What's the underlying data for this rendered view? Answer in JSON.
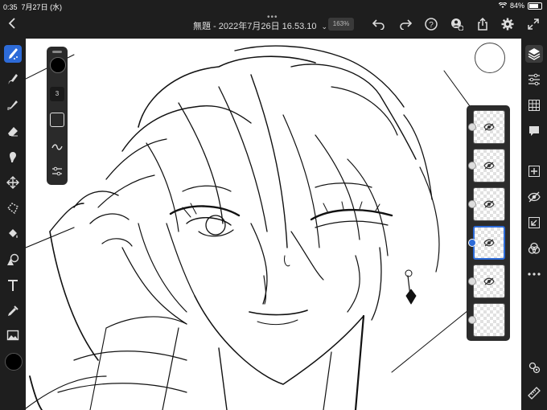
{
  "status": {
    "time": "0:35",
    "date": "7月27日 (水)",
    "battery": "84%"
  },
  "header": {
    "title": "無題 - 2022年7月26日 16.53.10",
    "zoom": "163%"
  },
  "brush_panel": {
    "size": "3"
  },
  "layers": [
    {
      "visible": false,
      "selected": false
    },
    {
      "visible": false,
      "selected": false
    },
    {
      "visible": false,
      "selected": false
    },
    {
      "visible": false,
      "selected": true
    },
    {
      "visible": false,
      "selected": false
    },
    {
      "visible": true,
      "selected": false
    }
  ],
  "colors": {
    "accent": "#2d6bd8",
    "foreground_color": "#000000"
  },
  "icons": {
    "left_tools": [
      "pixel-brush-icon",
      "live-brush-icon",
      "vector-brush-icon",
      "eraser-icon",
      "smudge-icon",
      "move-icon",
      "lasso-icon",
      "fill-icon",
      "shape-icon",
      "text-icon",
      "eyedropper-icon",
      "image-icon"
    ],
    "right_tools": [
      "layers-icon",
      "adjustments-icon",
      "grid-icon",
      "comment-icon",
      "add-layer-icon",
      "visibility-icon",
      "import-icon",
      "blend-icon",
      "more-icon",
      "settings-icon",
      "ruler-icon"
    ]
  }
}
